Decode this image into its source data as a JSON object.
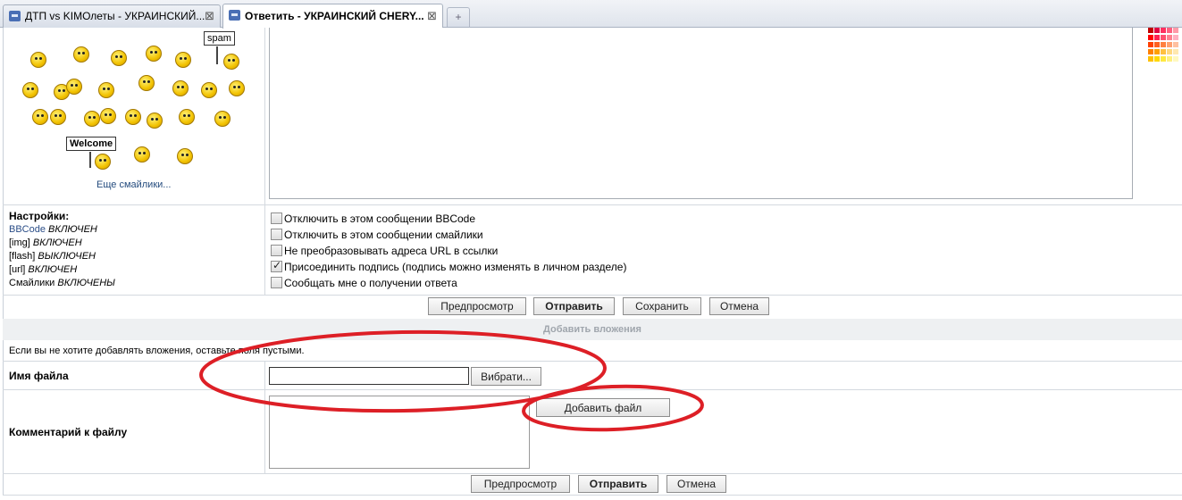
{
  "tabs": [
    {
      "label": "ДТП vs KIMОлеты - УКРАИНСКИЙ...",
      "close": "⊠",
      "active": false
    },
    {
      "label": "Ответить - УКРАИНСКИЙ CHERY...",
      "close": "⊠",
      "active": true
    }
  ],
  "new_tab_icon": "+",
  "smileys": {
    "signs": {
      "spam": "spam",
      "welcome": "Welcome"
    },
    "more_link": "Еще смайлики..."
  },
  "settings": {
    "title": "Настройки:",
    "lines": [
      {
        "key": "BBCode",
        "value": "ВКЛЮЧЕН"
      },
      {
        "key": "[img]",
        "value": "ВКЛЮЧЕН"
      },
      {
        "key": "[flash]",
        "value": "ВЫКЛЮЧЕН"
      },
      {
        "key": "[url]",
        "value": "ВКЛЮЧЕН"
      },
      {
        "key": "Смайлики",
        "value": "ВКЛЮЧЕНЫ"
      }
    ],
    "options": [
      {
        "label": "Отключить в этом сообщении BBCode",
        "checked": false
      },
      {
        "label": "Отключить в этом сообщении смайлики",
        "checked": false
      },
      {
        "label": "Не преобразовывать адреса URL в ссылки",
        "checked": false
      },
      {
        "label": "Присоединить подпись (подпись можно изменять в личном разделе)",
        "checked": true
      },
      {
        "label": "Сообщать мне о получении ответа",
        "checked": false
      }
    ]
  },
  "buttons": {
    "preview": "Предпросмотр",
    "submit": "Отправить",
    "save": "Сохранить",
    "cancel": "Отмена",
    "browse": "Вибрати...",
    "add_file": "Добавить файл"
  },
  "attachments": {
    "header": "Добавить вложения",
    "hint": "Если вы не хотите добавлять вложения, оставьте поля пустыми.",
    "filename_label": "Имя файла",
    "comment_label": "Комментарий к файлу"
  },
  "colors": {
    "annotation": "#dd1f26",
    "link": "#2a4d87"
  }
}
